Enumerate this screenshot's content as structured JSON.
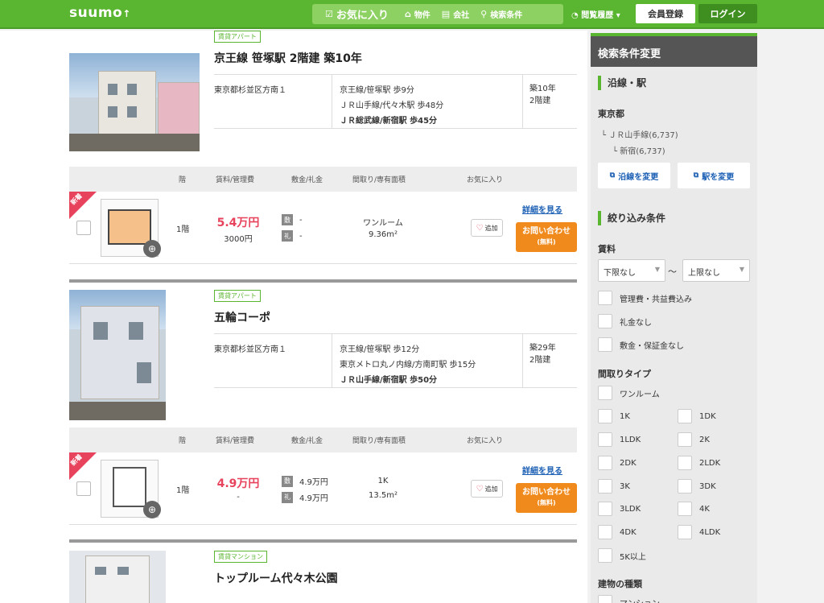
{
  "header": {
    "logo": "suumo",
    "nav": [
      {
        "icon": "favorite-list-icon",
        "label": "お気に入り"
      },
      {
        "icon": "house-icon",
        "label": "物件"
      },
      {
        "icon": "company-icon",
        "label": "会社"
      },
      {
        "icon": "search-icon",
        "label": "検索条件"
      }
    ],
    "history": "閲覧履歴",
    "register": "会員登録",
    "login": "ログイン"
  },
  "listings": [
    {
      "type_tag": "賃貸アパート",
      "title": "京王線 笹塚駅 2階建 築10年",
      "address": "東京都杉並区方南１",
      "stations": [
        "京王線/笹塚駅 歩9分",
        "ＪＲ山手線/代々木駅 歩48分",
        "ＪＲ総武線/新宿駅 歩45分"
      ],
      "age": "築10年",
      "floors": "2階建",
      "columns": {
        "floor": "階",
        "rent": "賃料/管理費",
        "deposit": "敷金/礼金",
        "layout": "間取り/専有面積",
        "fav": "お気に入り"
      },
      "room": {
        "new": "新着",
        "floor": "1階",
        "rent": "5.4万円",
        "fee": "3000円",
        "deposit_badge": "敷",
        "deposit": "-",
        "key_badge": "礼",
        "key_money": "-",
        "layout": "ワンルーム",
        "area": "9.36m²",
        "fav": "追加",
        "detail": "詳細を見る",
        "inquiry": "お問い合わせ",
        "inquiry_free": "(無料)"
      }
    },
    {
      "type_tag": "賃貸アパート",
      "title": "五輪コーポ",
      "address": "東京都杉並区方南１",
      "stations": [
        "京王線/笹塚駅 歩12分",
        "東京メトロ丸ノ内線/方南町駅 歩15分",
        "ＪＲ山手線/新宿駅 歩50分"
      ],
      "age": "築29年",
      "floors": "2階建",
      "columns": {
        "floor": "階",
        "rent": "賃料/管理費",
        "deposit": "敷金/礼金",
        "layout": "間取り/専有面積",
        "fav": "お気に入り"
      },
      "room": {
        "new": "新着",
        "floor": "1階",
        "rent": "4.9万円",
        "fee": "-",
        "deposit_badge": "敷",
        "deposit": "4.9万円",
        "key_badge": "礼",
        "key_money": "4.9万円",
        "layout": "1K",
        "area": "13.5m²",
        "fav": "追加",
        "detail": "詳細を見る",
        "inquiry": "お問い合わせ",
        "inquiry_free": "(無料)"
      }
    },
    {
      "type_tag": "賃貸マンション",
      "title": "トップルーム代々木公園"
    }
  ],
  "sidebar": {
    "heading": "検索条件変更",
    "line_station": "沿線・駅",
    "prefecture": "東京都",
    "line": "ＪＲ山手線(6,737)",
    "station": "新宿(6,737)",
    "change_line": "沿線を変更",
    "change_station": "駅を変更",
    "filter": "絞り込み条件",
    "rent_label": "賃料",
    "min": "下限なし",
    "max": "上限なし",
    "tilde": "～",
    "options": [
      "管理費・共益費込み",
      "礼金なし",
      "敷金・保証金なし"
    ],
    "layout_label": "間取りタイプ",
    "layouts": [
      "ワンルーム",
      "1K",
      "1DK",
      "1LDK",
      "2K",
      "2DK",
      "2LDK",
      "3K",
      "3DK",
      "3LDK",
      "4K",
      "4DK",
      "4LDK",
      "5K以上"
    ],
    "building_label": "建物の種類",
    "building_first": "マンション"
  }
}
